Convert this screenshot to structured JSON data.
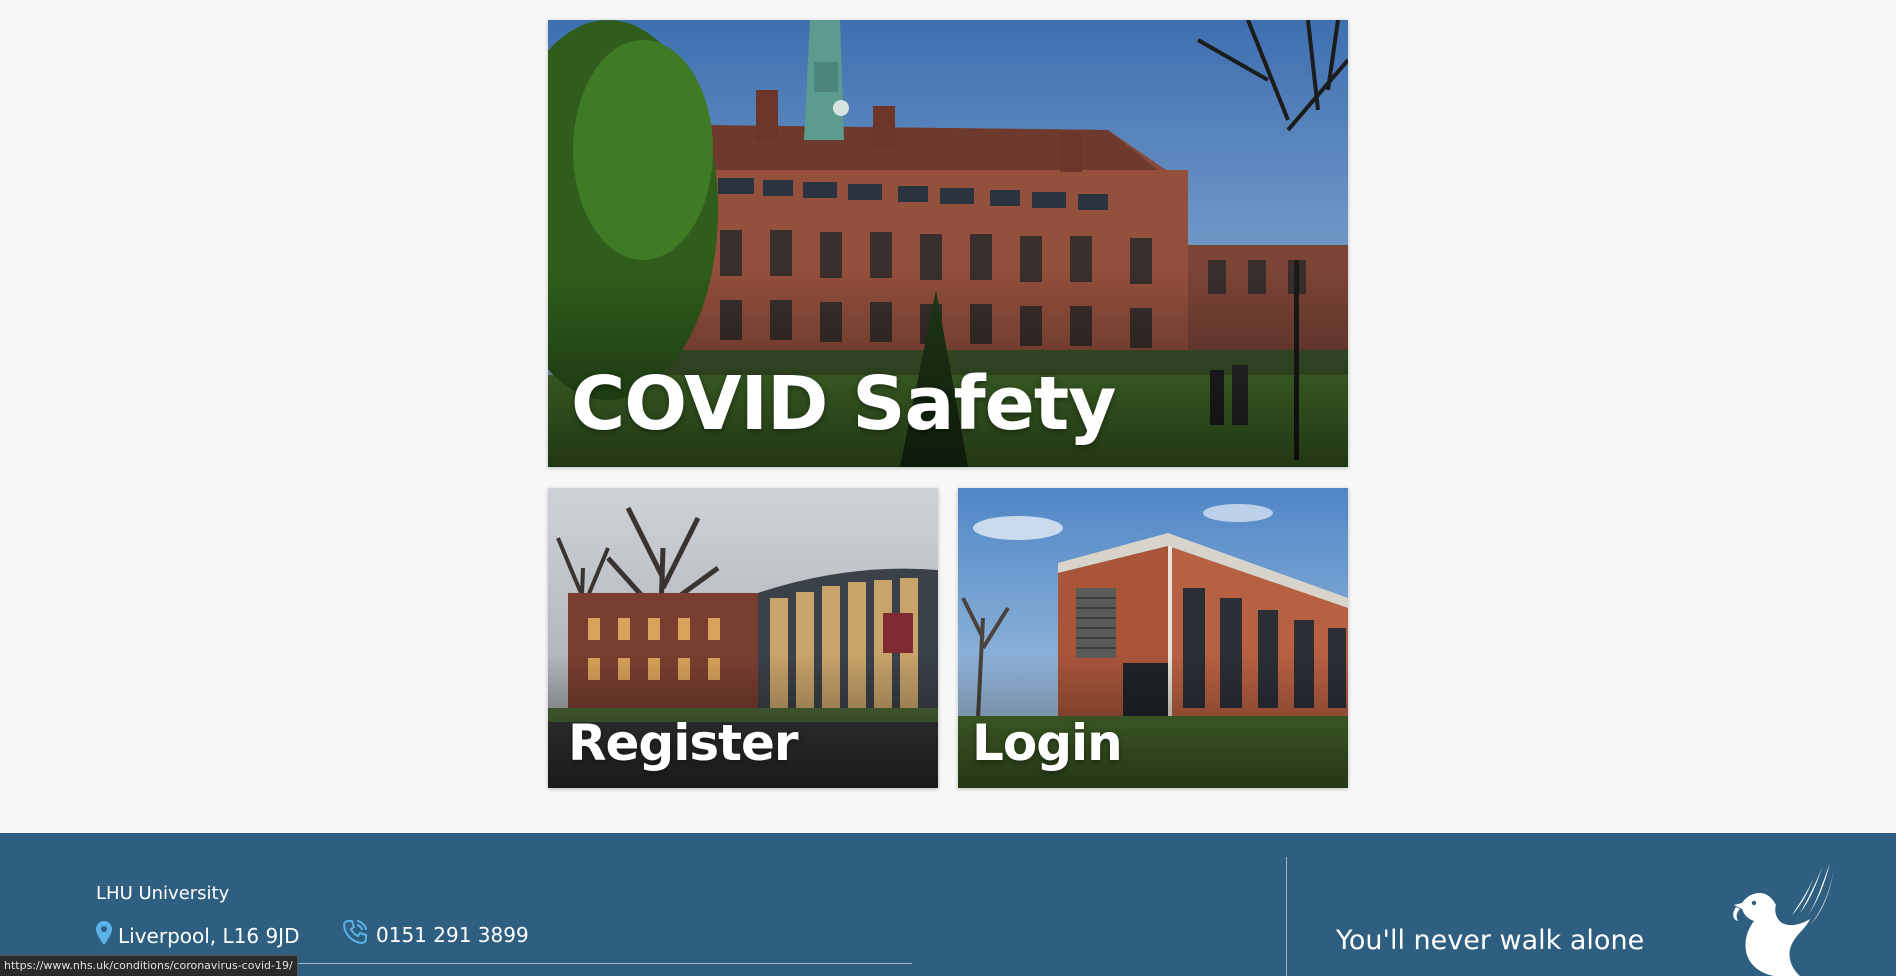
{
  "tiles": {
    "covid": {
      "label": "COVID Safety",
      "icon": "building-photo"
    },
    "register": {
      "label": "Register",
      "icon": "building-photo"
    },
    "login": {
      "label": "Login",
      "icon": "building-photo"
    }
  },
  "footer": {
    "name": "LHU University",
    "address": "Liverpool, L16 9JD",
    "phone": "0151 291 3899",
    "motto": "You'll never walk alone",
    "background_color": "#2f5f80",
    "icon_color": "#5bb0e8"
  },
  "status_bar": {
    "url": "https://www.nhs.uk/conditions/coronavirus-covid-19/"
  }
}
